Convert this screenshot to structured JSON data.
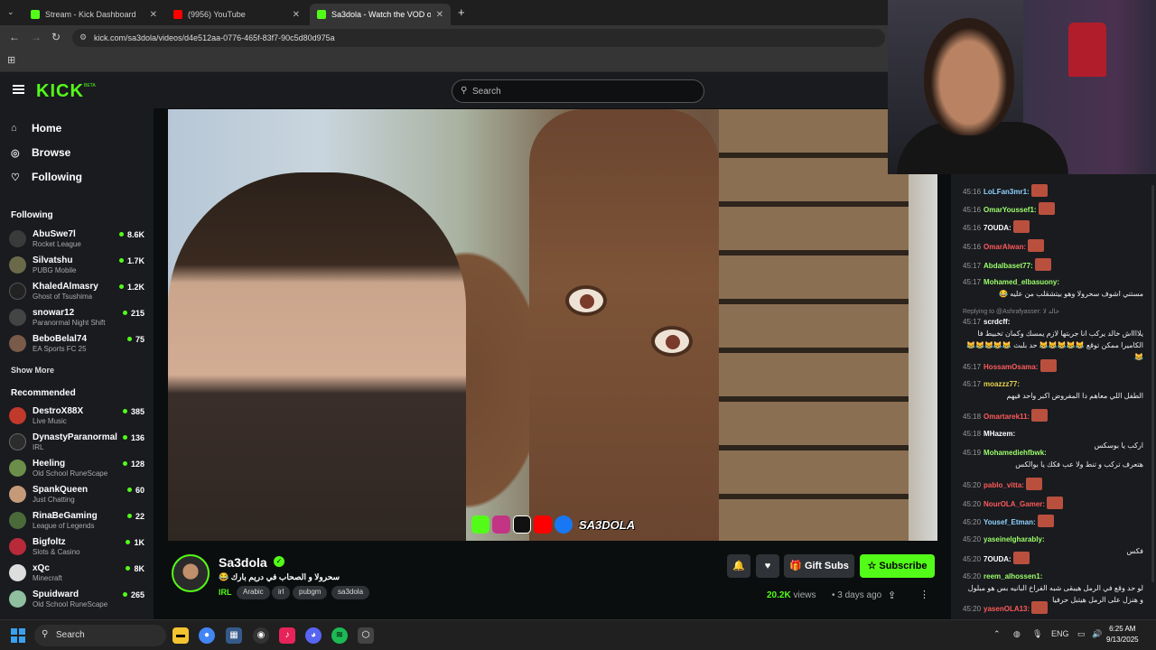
{
  "browser": {
    "tabs": [
      {
        "title": "Stream - Kick Dashboard",
        "favicon": "kick-icon",
        "color": "#53fc18"
      },
      {
        "title": "(9956) YouTube",
        "favicon": "youtube-icon",
        "color": "#ff0000"
      },
      {
        "title": "Sa3dola - Watch the VOD o",
        "favicon": "kick-icon",
        "color": "#53fc18"
      }
    ],
    "url": "kick.com/sa3dola/videos/d4e512aa-0776-465f-83f7-90c5d80d975a"
  },
  "header": {
    "logo": "KICK",
    "beta": "BETA",
    "search_placeholder": "Search"
  },
  "sidebar": {
    "nav": [
      {
        "label": "Home",
        "icon": "home-icon"
      },
      {
        "label": "Browse",
        "icon": "compass-icon"
      },
      {
        "label": "Following",
        "icon": "heart-icon"
      }
    ],
    "following_title": "Following",
    "following": [
      {
        "name": "AbuSwe7l",
        "game": "Rocket League",
        "viewers": "8.6K"
      },
      {
        "name": "Silvatshu",
        "game": "PUBG Mobile",
        "viewers": "1.7K"
      },
      {
        "name": "KhaledAlmasry",
        "game": "Ghost of Tsushima",
        "viewers": "1.2K"
      },
      {
        "name": "snowar12",
        "game": "Paranormal Night Shift",
        "viewers": "215"
      },
      {
        "name": "BeboBelal74",
        "game": "EA Sports FC 25",
        "viewers": "75"
      }
    ],
    "show_more": "Show More",
    "recommended_title": "Recommended",
    "recommended": [
      {
        "name": "DestroX88X",
        "game": "Live Music",
        "viewers": "385"
      },
      {
        "name": "DynastyParanormal",
        "game": "IRL",
        "viewers": "136"
      },
      {
        "name": "Heeling",
        "game": "Old School RuneScape",
        "viewers": "128"
      },
      {
        "name": "SpankQueen",
        "game": "Just Chatting",
        "viewers": "60"
      },
      {
        "name": "RinaBeGaming",
        "game": "League of Legends",
        "viewers": "22"
      },
      {
        "name": "Bigfoltz",
        "game": "Slots & Casino",
        "viewers": "1K"
      },
      {
        "name": "xQc",
        "game": "Minecraft",
        "viewers": "8K"
      },
      {
        "name": "Spuidward",
        "game": "Old School RuneScape",
        "viewers": "265"
      }
    ]
  },
  "video": {
    "watermark": "SA3DOLA"
  },
  "stream": {
    "streamer": "Sa3dola",
    "title": "سحرولا و الصحاب في دريم بارك 😂",
    "category": "IRL",
    "tags": [
      "Arabic",
      "irl",
      "pubgm",
      "sa3dola"
    ],
    "views": "20.2K",
    "views_label": "views",
    "ago": "3 days ago",
    "gift_subs": "Gift Subs",
    "subscribe": "Subscribe"
  },
  "chat": {
    "reply_to": "Replying to @Ashrafyasser: خالد لا",
    "messages": [
      {
        "time": "45:16",
        "user": "LoLFan3mr1:",
        "color": "#8fd3ff",
        "text": "",
        "emote": true
      },
      {
        "time": "45:16",
        "user": "OmarYoussef1:",
        "color": "#9cff6b",
        "text": "",
        "emote": true
      },
      {
        "time": "45:16",
        "user": "7OUDA:",
        "color": "#ffffff",
        "text": "",
        "emote": true
      },
      {
        "time": "45:16",
        "user": "OmarAlwan:",
        "color": "#ff5a5a",
        "text": "",
        "emote": true
      },
      {
        "time": "45:17",
        "user": "Abdalbaset77:",
        "color": "#9cff6b",
        "text": "",
        "emote": true
      },
      {
        "time": "45:17",
        "user": "Mohamed_elbasuony:",
        "color": "#9cff6b",
        "text": "مستني اشوف سحرولا وهو بيتشقلب من عليه 😂",
        "emote": false
      },
      {
        "time": "45:17",
        "user": "scrdcff:",
        "color": "#ffffff",
        "text": "يلااااش خالد يركب انا جربتها لازم يمسك وكمان تخبيط فا الكاميرا ممكن توقع 😹😹😹😹😹 حد بلبث 😹😹😹😹😹😹",
        "emote": false
      },
      {
        "time": "45:17",
        "user": "HossamOsama:",
        "color": "#ff5a5a",
        "text": "",
        "emote": true
      },
      {
        "time": "45:17",
        "user": "moazzz77:",
        "color": "#e8d44d",
        "text": "الطفل اللي معاهم دا المفروض اكبر واحد فيهم",
        "emote": false
      },
      {
        "time": "45:18",
        "user": "Omartarek11:",
        "color": "#ff5a5a",
        "text": "",
        "emote": true
      },
      {
        "time": "45:18",
        "user": "MHazem:",
        "color": "#ffffff",
        "text": "اركب يا بوسكس",
        "emote": false
      },
      {
        "time": "45:19",
        "user": "Mohamediehfbwk:",
        "color": "#9cff6b",
        "text": "هتعرف تركب و تنط ولا عب فكك يا بوالكس",
        "emote": false
      },
      {
        "time": "45:20",
        "user": "pablo_vitta:",
        "color": "#ff5a5a",
        "text": "",
        "emote": true
      },
      {
        "time": "45:20",
        "user": "NourOLA_Gamer:",
        "color": "#ff5a5a",
        "text": "",
        "emote": true
      },
      {
        "time": "45:20",
        "user": "Yousef_Etman:",
        "color": "#8fd3ff",
        "text": "",
        "emote": true
      },
      {
        "time": "45:20",
        "user": "yaseinelgharably:",
        "color": "#9cff6b",
        "text": "فكس",
        "emote": false
      },
      {
        "time": "45:20",
        "user": "7OUDA:",
        "color": "#ffffff",
        "text": "",
        "emote": true
      },
      {
        "time": "45:20",
        "user": "reem_alhossen1:",
        "color": "#9cff6b",
        "text": "لو حد وقع في الرمل هيبقى شبه الفراخ البانيه بس هو مبلول و هنزل على الرمل هيتبل حرفيا",
        "emote": false
      },
      {
        "time": "45:20",
        "user": "yasenOLA13:",
        "color": "#ff5a5a",
        "text": "",
        "emote": true
      }
    ]
  },
  "taskbar": {
    "search": "Search",
    "lang": "ENG",
    "time": "6:25 AM",
    "date": "9/13/2025"
  }
}
